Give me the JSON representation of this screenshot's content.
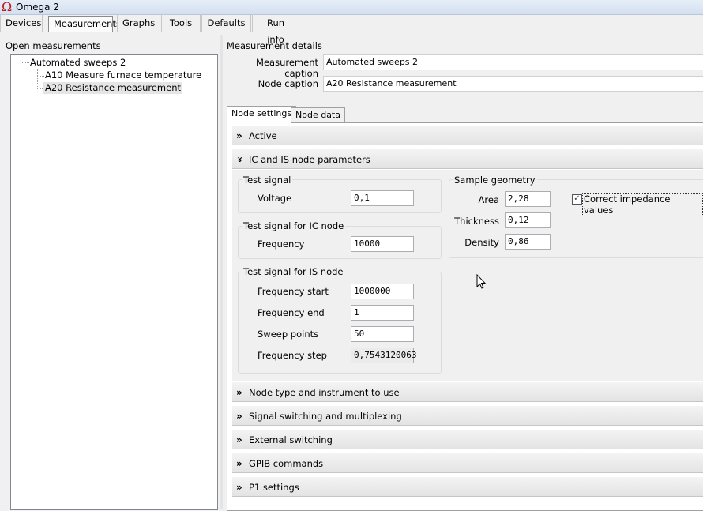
{
  "window": {
    "title": "Omega 2",
    "icon": "omega-icon"
  },
  "menu": {
    "tabs": [
      {
        "label": "Devices",
        "active": false
      },
      {
        "label": "Measurements",
        "active": true
      },
      {
        "label": "Graphs",
        "active": false
      },
      {
        "label": "Tools",
        "active": false
      },
      {
        "label": "Defaults",
        "active": false
      },
      {
        "label": "Run info",
        "active": false
      }
    ]
  },
  "left": {
    "title": "Open measurements",
    "tree": {
      "root": "Automated sweeps 2",
      "children": [
        "A10 Measure furnace temperature",
        "A20 Resistance measurement"
      ],
      "selected_index": 1
    }
  },
  "details": {
    "title": "Measurement details",
    "measurement_caption_label": "Measurement caption",
    "measurement_caption_value": "Automated sweeps 2",
    "node_caption_label": "Node caption",
    "node_caption_value": "A20 Resistance measurement",
    "tabs": [
      {
        "label": "Node settings",
        "active": true
      },
      {
        "label": "Node data",
        "active": false
      }
    ],
    "sections": {
      "active": "Active",
      "ic_is": "IC and IS node parameters",
      "node_type": "Node type and instrument to use",
      "signal_switching": "Signal switching and multiplexing",
      "external_switching": "External switching",
      "gpib": "GPIB commands",
      "p1": "P1 settings"
    },
    "test_signal": {
      "title": "Test signal",
      "voltage_label": "Voltage",
      "voltage_value": "0,1"
    },
    "test_signal_ic": {
      "title": "Test signal for IC node",
      "frequency_label": "Frequency",
      "frequency_value": "10000"
    },
    "test_signal_is": {
      "title": "Test signal for IS node",
      "freq_start_label": "Frequency start",
      "freq_start_value": "1000000",
      "freq_end_label": "Frequency end",
      "freq_end_value": "1",
      "sweep_points_label": "Sweep points",
      "sweep_points_value": "50",
      "freq_step_label": "Frequency step",
      "freq_step_value": "0,7543120063"
    },
    "sample_geometry": {
      "title": "Sample geometry",
      "area_label": "Area",
      "area_value": "2,28",
      "thickness_label": "Thickness",
      "thickness_value": "0,12",
      "density_label": "Density",
      "density_value": "0,86",
      "correct_impedance_label": "Correct impedance values",
      "correct_impedance_checked": true
    }
  }
}
